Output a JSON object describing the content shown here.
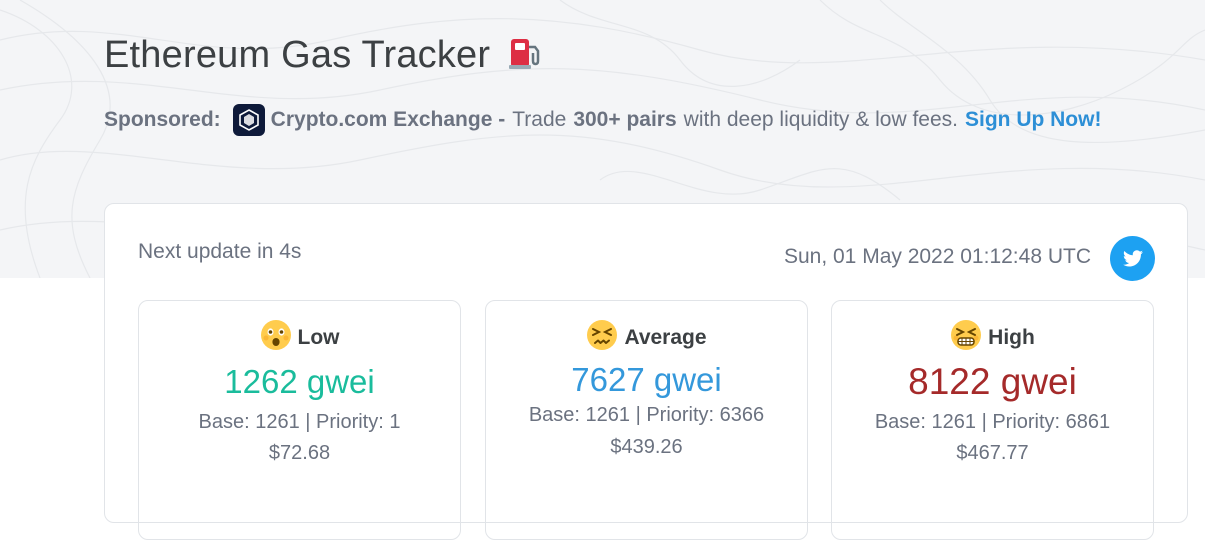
{
  "page": {
    "title": "Ethereum Gas Tracker",
    "title_icon": "fuel-pump-icon"
  },
  "sponsor": {
    "label": "Sponsored:",
    "exchange_name": "Crypto.com Exchange -",
    "text_trade": "Trade",
    "pairs": "300+ pairs",
    "text_rest": "with deep liquidity & low fees.",
    "cta": "Sign Up Now!",
    "logo_icon": "crypto-com-logo-icon"
  },
  "tracker": {
    "next_update": "Next update in 4s",
    "timestamp": "Sun, 01 May 2022 01:12:48 UTC",
    "share_icon": "twitter-icon",
    "tiers": [
      {
        "label": "Low",
        "emoji_icon": "astonished-face-icon",
        "gas": "1262 gwei",
        "details": "Base: 1261 | Priority: 1",
        "usd": "$72.68",
        "color": "#1abc9c"
      },
      {
        "label": "Average",
        "emoji_icon": "confounded-face-icon",
        "gas": "7627 gwei",
        "details": "Base: 1261 | Priority: 6366",
        "usd": "$439.26",
        "color": "#3498db"
      },
      {
        "label": "High",
        "emoji_icon": "woozy-face-icon",
        "gas": "8122 gwei",
        "details": "Base: 1261 | Priority: 6861",
        "usd": "$467.77",
        "color": "#a52a2a"
      }
    ]
  }
}
